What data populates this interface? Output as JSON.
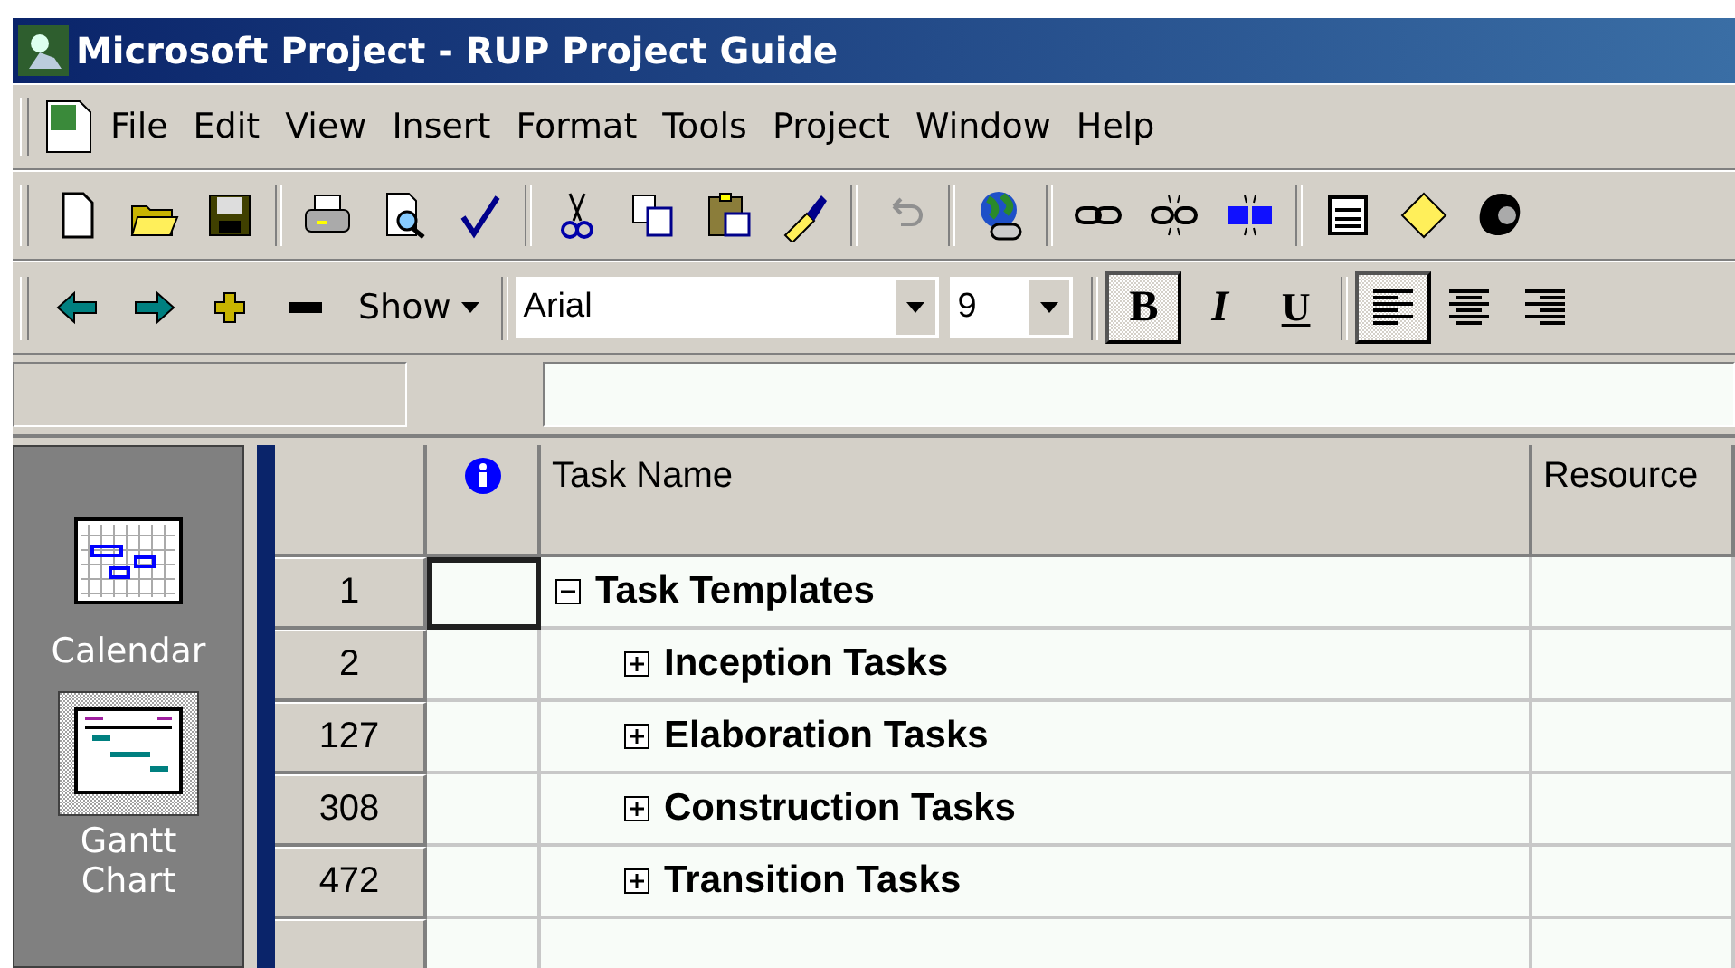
{
  "window": {
    "title": "Microsoft Project - RUP Project Guide"
  },
  "menu": [
    {
      "label": "File"
    },
    {
      "label": "Edit"
    },
    {
      "label": "View"
    },
    {
      "label": "Insert"
    },
    {
      "label": "Format"
    },
    {
      "label": "Tools"
    },
    {
      "label": "Project"
    },
    {
      "label": "Window"
    },
    {
      "label": "Help"
    }
  ],
  "standard_toolbar": {
    "undo": {
      "disabled": true
    }
  },
  "formatting_toolbar": {
    "show": {
      "label": "Show"
    },
    "font": "Arial",
    "size": "9",
    "styles": [
      {
        "label": "B",
        "kind": "bold",
        "selected": true
      },
      {
        "label": "I",
        "kind": "italic",
        "selected": false
      },
      {
        "label": "U",
        "kind": "underline",
        "selected": false
      }
    ],
    "alignment": [
      {
        "kind": "left",
        "selected": true
      },
      {
        "kind": "center",
        "selected": false
      },
      {
        "kind": "right",
        "selected": false
      }
    ]
  },
  "view_bar": [
    {
      "label": "Calendar",
      "kind": "calendar",
      "selected": false
    },
    {
      "label": "Gantt Chart",
      "kind": "gantt",
      "selected": true
    }
  ],
  "table": {
    "columns": [
      {
        "kind": "indicator"
      },
      {
        "kind": "text",
        "label": "Task Name"
      },
      {
        "kind": "text",
        "label": "Resource"
      }
    ],
    "rows": [
      {
        "id": "1",
        "name": "Task Templates",
        "expanded": true,
        "selected": true,
        "children": [
          {
            "id": "2",
            "name": "Inception Tasks",
            "expanded": false,
            "selected": false
          },
          {
            "id": "127",
            "name": "Elaboration Tasks",
            "expanded": false,
            "selected": false
          },
          {
            "id": "308",
            "name": "Construction Tasks",
            "expanded": false,
            "selected": false
          },
          {
            "id": "472",
            "name": "Transition Tasks",
            "expanded": false,
            "selected": false
          }
        ]
      }
    ]
  }
}
